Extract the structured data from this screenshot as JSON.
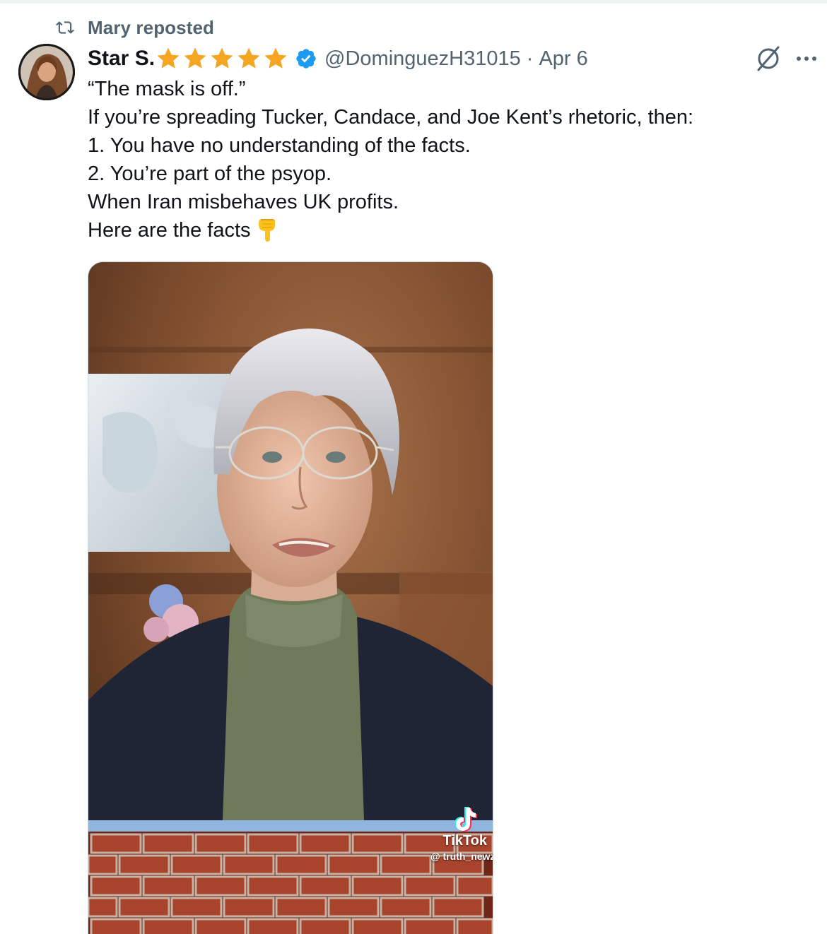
{
  "repost": {
    "icon": "repost-icon",
    "text": "Mary reposted"
  },
  "author": {
    "display_name": "Star S.",
    "star_count": 5,
    "star_color": "#f4a622",
    "verified_color": "#1d9bf0",
    "handle": "@DominguezH31015",
    "separator": "·",
    "date": "Apr 6"
  },
  "tweet": {
    "lines": [
      "“The mask is off.”",
      "If you’re spreading Tucker, Candace, and Joe Kent’s rhetoric, then:",
      "1.  You have no understanding of the facts.",
      "2.  You’re part of the psyop.",
      "When Iran misbehaves UK profits.",
      "Here are the facts"
    ],
    "trailing_emoji": "backhand-index-pointing-down"
  },
  "media": {
    "watermark_brand": "TikTok",
    "watermark_user": "@ truth_newz"
  },
  "actions": {
    "grok_icon": "grok-icon",
    "more_icon": "more-icon"
  },
  "colors": {
    "text_primary": "#0f1419",
    "text_secondary": "#536471",
    "border": "#cfd9de"
  }
}
